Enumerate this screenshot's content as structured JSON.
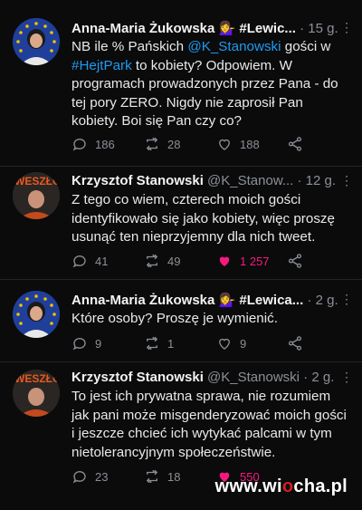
{
  "tweets": [
    {
      "name": "Anna-Maria Żukowska 💁‍♀️ #Lewic...",
      "time": "15 g.",
      "text_parts": [
        "NB ile % Pańskich ",
        "@K_Stanowski",
        " gości w ",
        "#HejtPark",
        " to kobiety? Odpowiem. W programach prowadzonych przez Pana - do tej pory ZERO. Nigdy nie zaprosił Pan kobiety. Boi się Pan czy co?"
      ],
      "replies": "186",
      "retweets": "28",
      "likes": "188"
    },
    {
      "name": "Krzysztof Stanowski",
      "handle": "@K_Stanow...",
      "time": "12 g.",
      "text": "Z tego co wiem, czterech moich gości identyfikowało się jako kobiety, więc proszę usunąć ten nieprzyjemny dla nich tweet.",
      "replies": "41",
      "retweets": "49",
      "likes": "1 257"
    },
    {
      "name": "Anna-Maria Żukowska 💁‍♀️ #Lewica...",
      "time": "2 g.",
      "text": "Które osoby? Proszę je wymienić.",
      "replies": "9",
      "retweets": "1",
      "likes": "9"
    },
    {
      "name": "Krzysztof Stanowski",
      "handle": "@K_Stanowski",
      "time": "2 g.",
      "text": "To jest ich prywatna sprawa, nie rozumiem jak pani może misgenderyzować moich gości i jeszcze chcieć ich wytykać palcami w tym nietolerancyjnym społeczeństwie.",
      "replies": "23",
      "retweets": "18",
      "likes": "550"
    }
  ],
  "watermark": {
    "pre": "www.wi",
    "o": "o",
    "post": "cha.pl"
  },
  "colors": {
    "background": "#0b0b0c",
    "link": "#1d9bf0",
    "like": "#f91880",
    "muted": "#8b9096"
  }
}
